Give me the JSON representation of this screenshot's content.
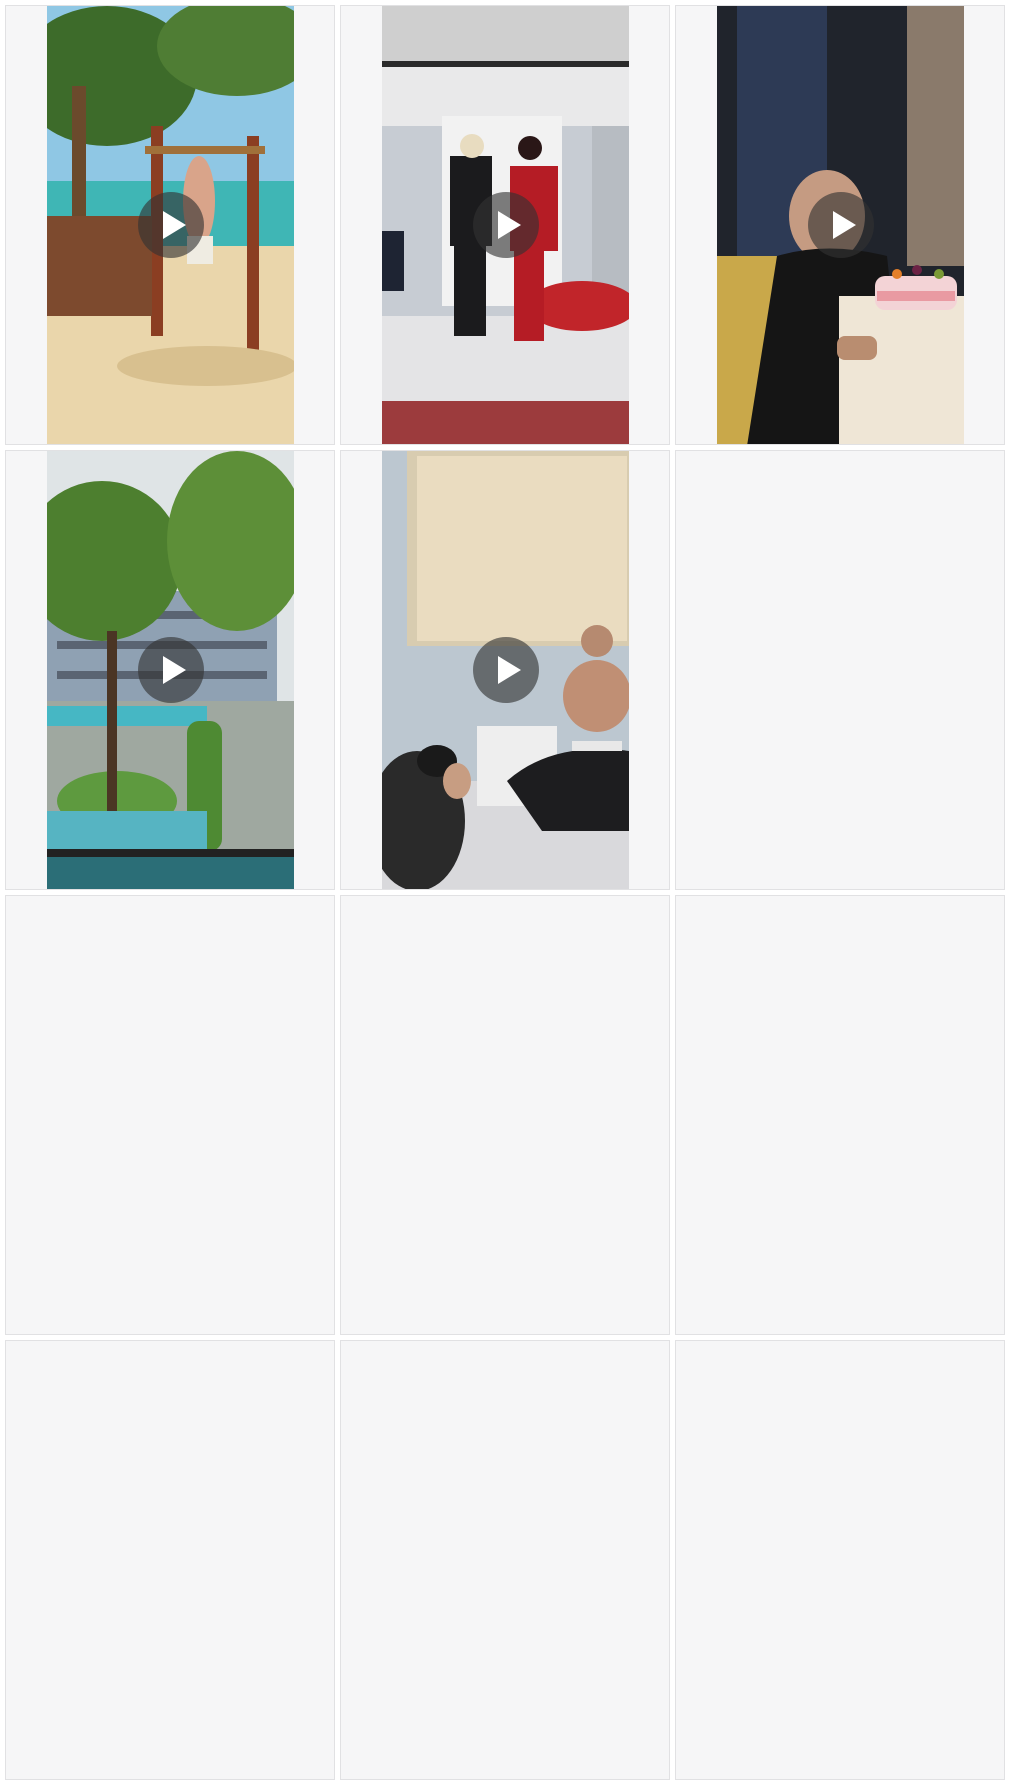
{
  "grid": {
    "tiles": [
      {
        "type": "video",
        "subject": "beach-pullup-bar",
        "play_icon": "play-icon"
      },
      {
        "type": "video",
        "subject": "fashion-stage-red-outfit",
        "play_icon": "play-icon"
      },
      {
        "type": "video",
        "subject": "man-with-birthday-cake",
        "play_icon": "play-icon"
      },
      {
        "type": "video",
        "subject": "resort-pool-view",
        "play_icon": "play-icon"
      },
      {
        "type": "video",
        "subject": "photoshoot-studio",
        "play_icon": "play-icon"
      },
      {
        "type": "placeholder"
      },
      {
        "type": "placeholder"
      },
      {
        "type": "placeholder"
      },
      {
        "type": "placeholder"
      },
      {
        "type": "placeholder"
      },
      {
        "type": "placeholder"
      },
      {
        "type": "placeholder"
      }
    ]
  },
  "colors": {
    "placeholder_bg": "#f6f6f7",
    "tile_border": "#e1e1e3",
    "play_button_bg": "#323232"
  }
}
